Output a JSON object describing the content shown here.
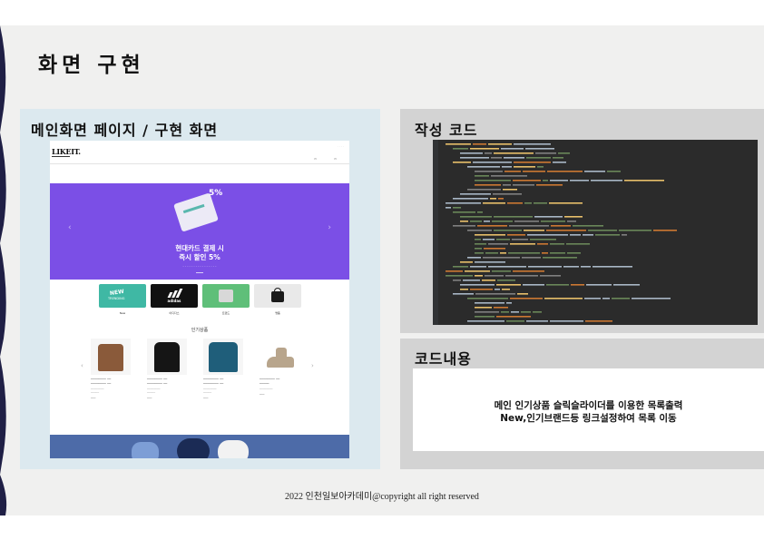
{
  "page": {
    "title": "화면 구현"
  },
  "panels": {
    "main_screen": {
      "title": "메인화면 페이지 / 구현 화면"
    },
    "code": {
      "title": "작성 코드"
    },
    "content": {
      "title": "코드내용",
      "line1": "메인 인기상품 슬릭슬라이더를 이용한 목록출력",
      "line2": "New,인기브랜드등 링크설정하여 목록 이동"
    }
  },
  "mockup": {
    "logo": "LIKEIT.",
    "hero": {
      "percent": "5%",
      "headline1": "현대카드 결제 시",
      "headline2": "즉시 할인 5%"
    },
    "brands": [
      {
        "label": "New",
        "text": "NEW TRENDING",
        "color": "#3fb8a4"
      },
      {
        "label": "아디다스",
        "text": "adidas",
        "color": "#111111"
      },
      {
        "label": "트렌드",
        "text": "",
        "color": "#5fbf79"
      },
      {
        "label": "명품",
        "text": "",
        "color": "#e9e9e9"
      }
    ],
    "section_title": "인기상품",
    "products": [
      {
        "color": "#8a5a3a"
      },
      {
        "color": "#151515"
      },
      {
        "color": "#1f5e7a"
      },
      {
        "color": "#b8a58c"
      }
    ]
  },
  "code": {
    "colors": {
      "keyword": "#cc7832",
      "string": "#6a8759",
      "text": "#a9b7c6",
      "tag": "#e8bf6a",
      "comment": "#808080"
    }
  },
  "footer": {
    "text": "2022 인천일보아카데미@copyright all right reserved"
  },
  "theme": {
    "band": "#f0f0ef",
    "left_panel": "#dce9ef",
    "right_panel": "#d3d3d3",
    "decor": "#1f1f45"
  }
}
